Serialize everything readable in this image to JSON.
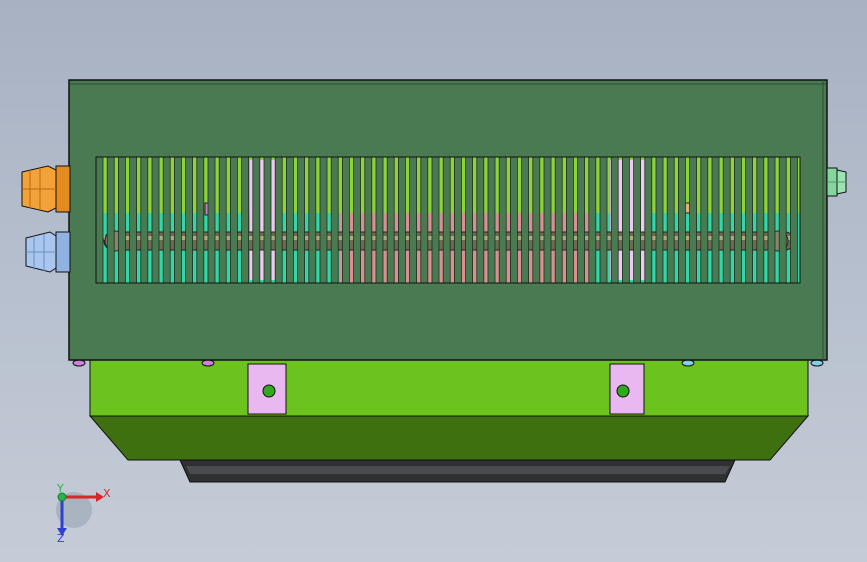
{
  "viewport": {
    "background_top": "#a7b1c2",
    "background_bottom": "#c6ccd7"
  },
  "model": {
    "enclosure_color": "#497a52",
    "base_color": "#6cc21e",
    "base_shadow_color": "#3d6b12",
    "slot_color": "#9ee23a",
    "mount_tab_color": "#eab8f0",
    "gland_orange": "#f3a23a",
    "gland_blue": "#a9c6ef",
    "gland_green": "#9be3b0"
  },
  "triad": {
    "x_label": "X",
    "y_label": "Y",
    "z_label": "Z",
    "x_color": "#d8262a",
    "y_color": "#2bb24a",
    "z_color": "#2f3fd0"
  }
}
